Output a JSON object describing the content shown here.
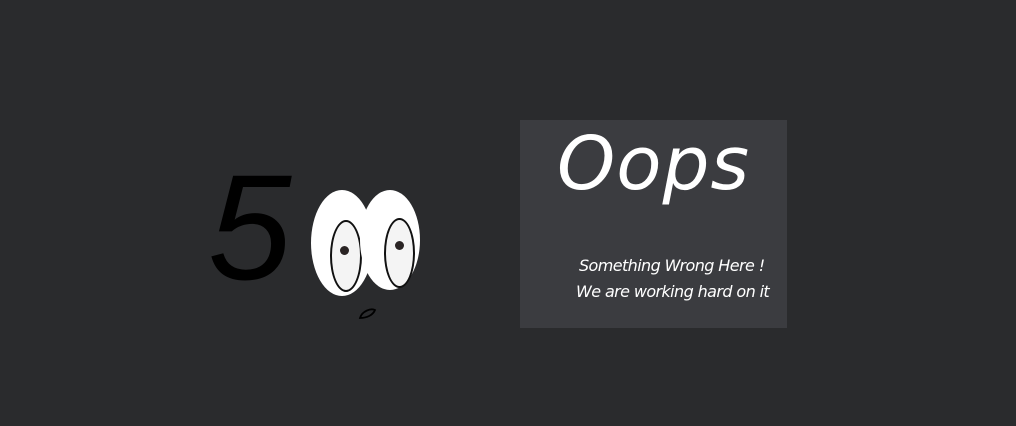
{
  "error_figure": {
    "digit": "5"
  },
  "panel": {
    "heading": "Oops",
    "line1": "Something Wrong Here !",
    "line2": "We are working hard on it"
  }
}
